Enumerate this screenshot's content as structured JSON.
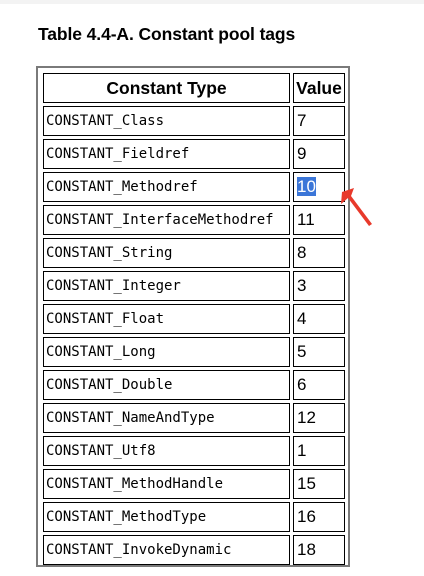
{
  "caption": "Table 4.4-A. Constant pool tags",
  "headers": {
    "type": "Constant Type",
    "value": "Value"
  },
  "rows": [
    {
      "type": "CONSTANT_Class",
      "value": "7"
    },
    {
      "type": "CONSTANT_Fieldref",
      "value": "9"
    },
    {
      "type": "CONSTANT_Methodref",
      "value": "10",
      "selected": true
    },
    {
      "type": "CONSTANT_InterfaceMethodref",
      "value": "11"
    },
    {
      "type": "CONSTANT_String",
      "value": "8"
    },
    {
      "type": "CONSTANT_Integer",
      "value": "3"
    },
    {
      "type": "CONSTANT_Float",
      "value": "4"
    },
    {
      "type": "CONSTANT_Long",
      "value": "5"
    },
    {
      "type": "CONSTANT_Double",
      "value": "6"
    },
    {
      "type": "CONSTANT_NameAndType",
      "value": "12"
    },
    {
      "type": "CONSTANT_Utf8",
      "value": "1"
    },
    {
      "type": "CONSTANT_MethodHandle",
      "value": "15"
    },
    {
      "type": "CONSTANT_MethodType",
      "value": "16"
    },
    {
      "type": "CONSTANT_InvokeDynamic",
      "value": "18"
    }
  ],
  "colors": {
    "selection": "#3b76d8",
    "annotation_arrow": "#e8392b"
  }
}
